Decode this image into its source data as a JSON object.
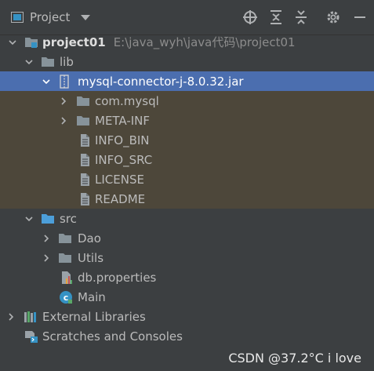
{
  "toolbar": {
    "title": "Project",
    "icons": [
      "project-icon",
      "dropdown-icon",
      "locate-icon",
      "expand-all-icon",
      "collapse-all-icon",
      "gear-icon",
      "minimize-icon"
    ]
  },
  "tree": {
    "project": {
      "name": "project01",
      "path": "E:\\java_wyh\\java代码\\project01"
    },
    "lib": {
      "label": "lib"
    },
    "jar": {
      "label": "mysql-connector-j-8.0.32.jar"
    },
    "jar_children": [
      {
        "label": "com.mysql",
        "kind": "folder"
      },
      {
        "label": "META-INF",
        "kind": "folder"
      },
      {
        "label": "INFO_BIN",
        "kind": "file"
      },
      {
        "label": "INFO_SRC",
        "kind": "file"
      },
      {
        "label": "LICENSE",
        "kind": "file"
      },
      {
        "label": "README",
        "kind": "file"
      }
    ],
    "src": {
      "label": "src"
    },
    "src_children": [
      {
        "label": "Dao",
        "kind": "package"
      },
      {
        "label": "Utils",
        "kind": "package"
      },
      {
        "label": "db.properties",
        "kind": "properties"
      },
      {
        "label": "Main",
        "kind": "class"
      }
    ],
    "external_libraries": "External Libraries",
    "scratches": "Scratches and Consoles"
  },
  "colors": {
    "background": "#3c3f41",
    "selection": "#4b6eaf",
    "library_highlight": "#4d473a",
    "folder": "#87939a",
    "source_folder": "#4c9ed9"
  },
  "watermark": "CSDN @37.2°C i love"
}
